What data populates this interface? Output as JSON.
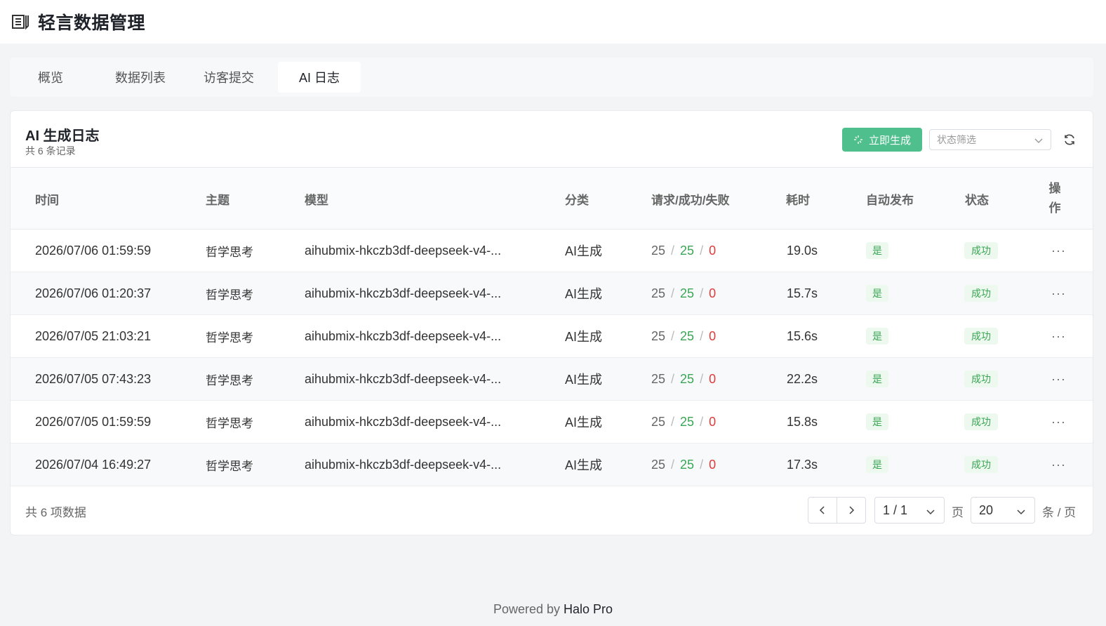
{
  "app": {
    "title": "轻言数据管理"
  },
  "tabs": [
    {
      "label": "概览"
    },
    {
      "label": "数据列表"
    },
    {
      "label": "访客提交"
    },
    {
      "label": "AI 日志"
    }
  ],
  "card": {
    "title": "AI 生成日志",
    "subtitle": "共 6 条记录",
    "generate_label": "立即生成",
    "status_placeholder": "状态筛选"
  },
  "columns": {
    "time": "时间",
    "topic": "主题",
    "model": "模型",
    "category": "分类",
    "counts": "请求/成功/失败",
    "duration": "耗时",
    "auto_publish": "自动发布",
    "status": "状态",
    "op_line1": "操",
    "op_line2": "作"
  },
  "rows": [
    {
      "time": "2026/07/06 01:59:59",
      "topic": "哲学思考",
      "model": "aihubmix-hkczb3df-deepseek-v4-...",
      "category": "AI生成",
      "req": "25",
      "ok": "25",
      "fail": "0",
      "duration": "19.0s",
      "auto": "是",
      "status": "成功"
    },
    {
      "time": "2026/07/06 01:20:37",
      "topic": "哲学思考",
      "model": "aihubmix-hkczb3df-deepseek-v4-...",
      "category": "AI生成",
      "req": "25",
      "ok": "25",
      "fail": "0",
      "duration": "15.7s",
      "auto": "是",
      "status": "成功"
    },
    {
      "time": "2026/07/05 21:03:21",
      "topic": "哲学思考",
      "model": "aihubmix-hkczb3df-deepseek-v4-...",
      "category": "AI生成",
      "req": "25",
      "ok": "25",
      "fail": "0",
      "duration": "15.6s",
      "auto": "是",
      "status": "成功"
    },
    {
      "time": "2026/07/05 07:43:23",
      "topic": "哲学思考",
      "model": "aihubmix-hkczb3df-deepseek-v4-...",
      "category": "AI生成",
      "req": "25",
      "ok": "25",
      "fail": "0",
      "duration": "22.2s",
      "auto": "是",
      "status": "成功"
    },
    {
      "time": "2026/07/05 01:59:59",
      "topic": "哲学思考",
      "model": "aihubmix-hkczb3df-deepseek-v4-...",
      "category": "AI生成",
      "req": "25",
      "ok": "25",
      "fail": "0",
      "duration": "15.8s",
      "auto": "是",
      "status": "成功"
    },
    {
      "time": "2026/07/04 16:49:27",
      "topic": "哲学思考",
      "model": "aihubmix-hkczb3df-deepseek-v4-...",
      "category": "AI生成",
      "req": "25",
      "ok": "25",
      "fail": "0",
      "duration": "17.3s",
      "auto": "是",
      "status": "成功"
    }
  ],
  "table_symbols": {
    "separator": "/",
    "more": "···"
  },
  "pagination": {
    "total_text": "共 6 项数据",
    "page_value": "1 / 1",
    "page_unit": "页",
    "size_value": "20",
    "size_unit": "条 / 页"
  },
  "footer": {
    "powered_prefix": "Powered by ",
    "powered_brand": "Halo Pro"
  },
  "icons": {
    "app": "book-list-icon",
    "generate": "sparkle-icon",
    "dropdown": "chevron-down-icon",
    "refresh": "refresh-icon",
    "prev": "chevron-left-icon",
    "next": "chevron-right-icon",
    "more": "ellipsis-icon"
  },
  "colors": {
    "accent": "#4fc08d",
    "success": "#3aa655",
    "danger": "#e03a3a",
    "background": "#f2f4f6"
  }
}
